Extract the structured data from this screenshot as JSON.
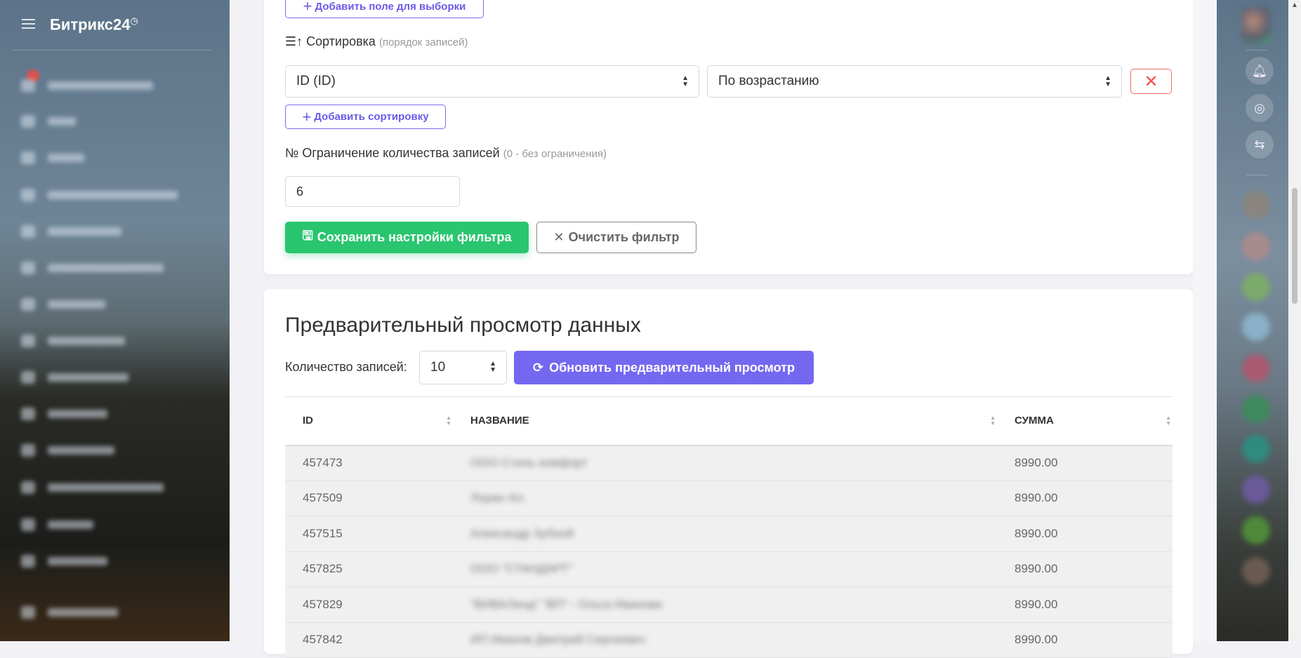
{
  "sidebar": {
    "title": "Битрикс24",
    "clock_icon": "clock-icon"
  },
  "filter": {
    "add_field_label": "Добавить поле для выборки",
    "sort_label": "Сортировка",
    "sort_hint": "(порядок записей)",
    "sort_field": "ID (ID)",
    "sort_order": "По возрастанию",
    "add_sort_label": "Добавить сортировку",
    "limit_label": "Ограничение количества записей",
    "limit_hint": "(0 - без ограничения)",
    "limit_value": "6",
    "save_label": "Сохранить настройки фильтра",
    "clear_label": "Очистить фильтр"
  },
  "preview": {
    "title": "Предварительный просмотр данных",
    "count_label": "Количество записей:",
    "count_value": "10",
    "refresh_label": "Обновить предварительный просмотр",
    "columns": [
      "ID",
      "НАЗВАНИЕ",
      "СУММА"
    ],
    "rows": [
      {
        "id": "457473",
        "name": "ООО Стиль комфорт",
        "sum": "8990.00"
      },
      {
        "id": "457509",
        "name": "Лоран Ал.",
        "sum": "8990.00"
      },
      {
        "id": "457515",
        "name": "Александр Зубной",
        "sum": "8990.00"
      },
      {
        "id": "457825",
        "name": "ООО \"СТАНДАРТ\"",
        "sum": "8990.00"
      },
      {
        "id": "457829",
        "name": "\"ВИВАЛенд\" \"ВП\" - Ольга Иванова",
        "sum": "8990.00"
      },
      {
        "id": "457842",
        "name": "ИП Иванов Дмитрий Сергеевич",
        "sum": "8990.00"
      }
    ]
  },
  "colors": {
    "accent": "#7468f0",
    "success": "#2ac56f",
    "danger": "#f05050"
  }
}
